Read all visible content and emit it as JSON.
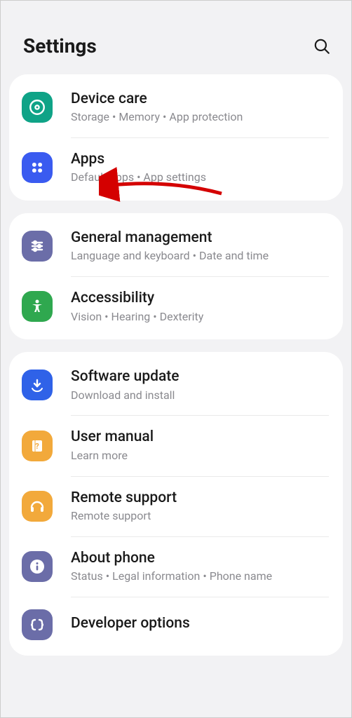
{
  "header": {
    "title": "Settings"
  },
  "groups": [
    {
      "items": [
        {
          "id": "device-care",
          "title": "Device care",
          "subtitle": "Storage  •  Memory  •  App protection",
          "color": "#0fa387"
        },
        {
          "id": "apps",
          "title": "Apps",
          "subtitle": "Default apps  •  App settings",
          "color": "#3a5bf0"
        }
      ]
    },
    {
      "items": [
        {
          "id": "general-management",
          "title": "General management",
          "subtitle": "Language and keyboard  •  Date and time",
          "color": "#6b6da8"
        },
        {
          "id": "accessibility",
          "title": "Accessibility",
          "subtitle": "Vision  •  Hearing  •  Dexterity",
          "color": "#2fa84f"
        }
      ]
    },
    {
      "items": [
        {
          "id": "software-update",
          "title": "Software update",
          "subtitle": "Download and install",
          "color": "#2f62e8"
        },
        {
          "id": "user-manual",
          "title": "User manual",
          "subtitle": "Learn more",
          "color": "#f2a93b"
        },
        {
          "id": "remote-support",
          "title": "Remote support",
          "subtitle": "Remote support",
          "color": "#f2a93b"
        },
        {
          "id": "about-phone",
          "title": "About phone",
          "subtitle": "Status  •  Legal information  •  Phone name",
          "color": "#6b6da8"
        },
        {
          "id": "developer-options",
          "title": "Developer options",
          "subtitle": "",
          "color": "#6b6da8"
        }
      ]
    }
  ],
  "annotation": {
    "target": "apps"
  }
}
